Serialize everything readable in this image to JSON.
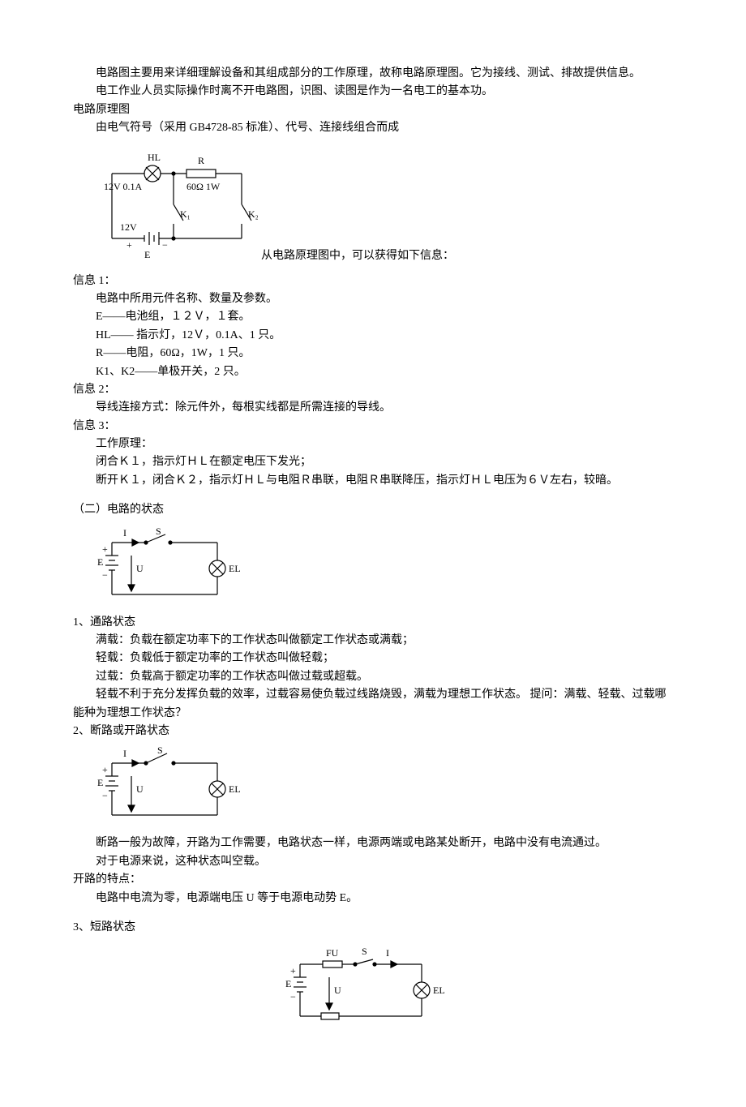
{
  "intro": {
    "p1": "电路图主要用来详细理解设备和其组成部分的工作原理，故称电路原理图。它为接线、测试、排故提供信息。",
    "p2": "电工作业人员实际操作时离不开电路图，识图、读图是作为一名电工的基本功。",
    "h1": "电路原理图",
    "p3": "由电气符号（采用 GB4728-85 标准）、代号、连接线组合而成"
  },
  "diagram1": {
    "HL": "HL",
    "R": "R",
    "v12_01a": "12V 0.1A",
    "r60_1w": "60Ω 1W",
    "v12": "12V",
    "K1": "K₁",
    "K2": "K₂",
    "plus": "+",
    "minus": "−",
    "E": "E",
    "caption": "从电路原理图中，可以获得如下信息："
  },
  "info1": {
    "title": "信息 1：",
    "p1": "电路中所用元件名称、数量及参数。",
    "p2": "E——电池组，１２Ｖ，１套。",
    "p3": "HL—— 指示灯，12Ｖ，0.1A、1 只。",
    "p4": "R——电阻，60Ω，1W，1 只。",
    "p5": "K1、K2——单极开关，2 只。"
  },
  "info2": {
    "title": "信息 2：",
    "p1": "导线连接方式：除元件外，每根实线都是所需连接的导线。"
  },
  "info3": {
    "title": "信息 3：",
    "p1": "工作原理：",
    "p2": "闭合Ｋ１，指示灯ＨＬ在额定电压下发光；",
    "p3": "断开Ｋ１，闭合Ｋ２，指示灯ＨＬ与电阻Ｒ串联，电阻Ｒ串联降压，指示灯ＨＬ电压为６Ｖ左右，较暗。"
  },
  "section2": {
    "title": "（二）电路的状态"
  },
  "diagram2": {
    "I": "I",
    "S": "S",
    "E": "E",
    "U": "U",
    "EL": "EL",
    "plus": "+",
    "minus": "−"
  },
  "state1": {
    "title": "1、通路状态",
    "p1": "满载：负载在额定功率下的工作状态叫做额定工作状态或满载；",
    "p2": "轻载：负载低于额定功率的工作状态叫做轻载；",
    "p3": "过载：负载高于额定功率的工作状态叫做过载或超载。",
    "p4": "轻载不利于充分发挥负载的效率，过载容易使负载过线路烧毁，满载为理想工作状态。 提问：满载、轻载、过载哪能种为理想工作状态？"
  },
  "state2": {
    "title": "2、断路或开路状态",
    "p1": "断路一般为故障，开路为工作需要，电路状态一样，电源两端或电路某处断开，电路中没有电流通过。",
    "p2": "对于电源来说，这种状态叫空载。",
    "sub": "开路的特点：",
    "p3": "电路中电流为零，电源端电压 U 等于电源电动势 E。"
  },
  "state3": {
    "title": "3、短路状态"
  },
  "diagram4": {
    "FU": "FU",
    "S": "S",
    "I": "I",
    "E": "E",
    "U": "U",
    "EL": "EL",
    "plus": "+",
    "minus": "−"
  }
}
